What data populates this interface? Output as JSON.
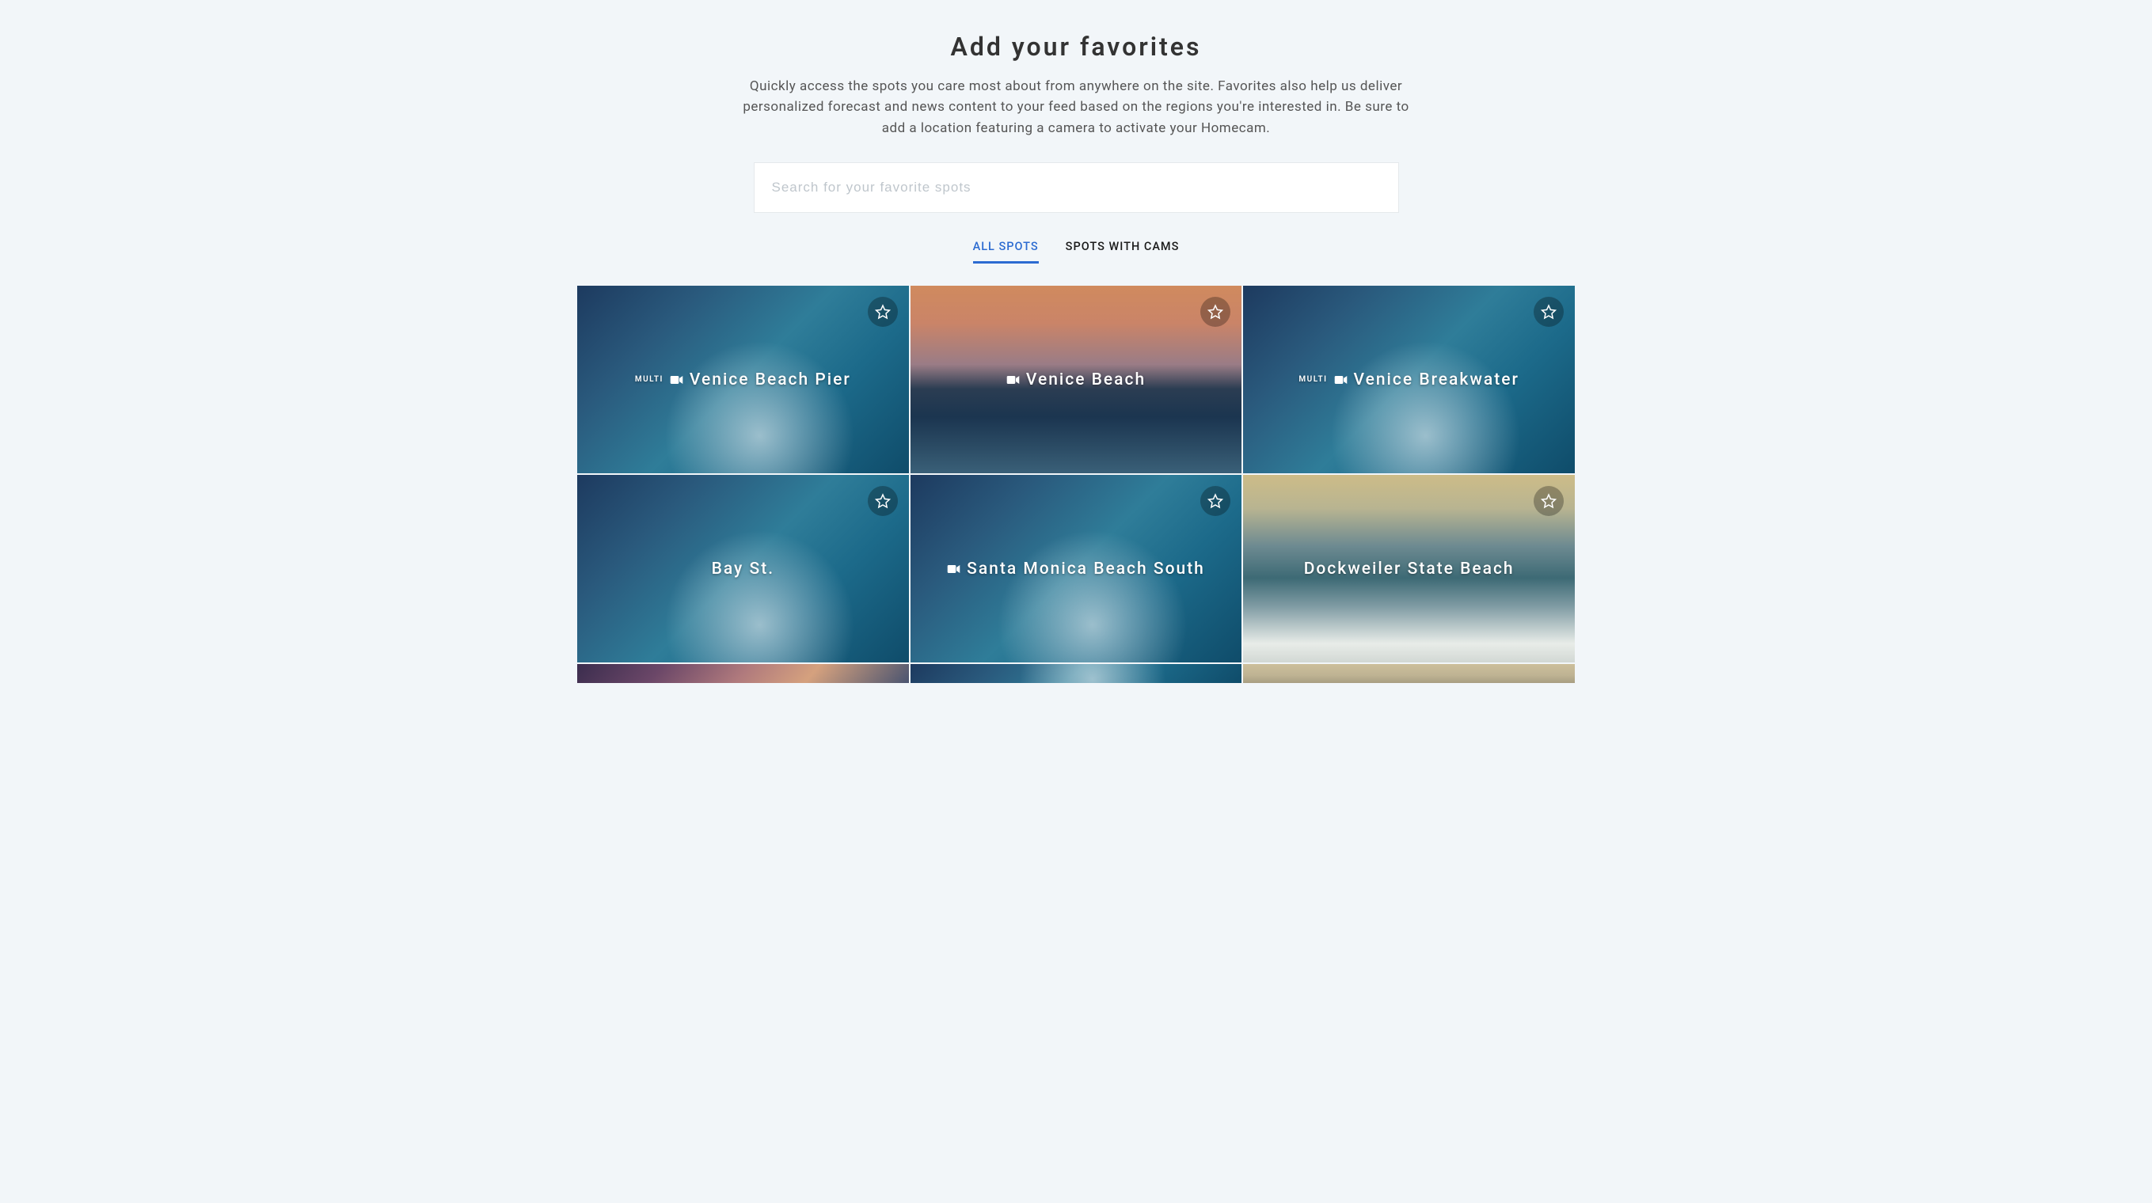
{
  "header": {
    "title": "Add your favorites",
    "subtitle": "Quickly access the spots you care most about from anywhere on the site. Favorites also help us deliver personalized forecast and news content to your feed based on the regions you're interested in. Be sure to add a location featuring a camera to activate your Homecam."
  },
  "search": {
    "placeholder": "Search for your favorite spots"
  },
  "tabs": {
    "all": "ALL SPOTS",
    "cams": "SPOTS WITH CAMS"
  },
  "multi_label": "MULTI",
  "spots": [
    {
      "name": "Venice Beach Pier",
      "multi": true,
      "cam": true,
      "bg": "bg-wave"
    },
    {
      "name": "Venice Beach",
      "multi": false,
      "cam": true,
      "bg": "bg-sunset"
    },
    {
      "name": "Venice Breakwater",
      "multi": true,
      "cam": true,
      "bg": "bg-wave"
    },
    {
      "name": "Bay St.",
      "multi": false,
      "cam": false,
      "bg": "bg-wave"
    },
    {
      "name": "Santa Monica Beach South",
      "multi": false,
      "cam": true,
      "bg": "bg-wave"
    },
    {
      "name": "Dockweiler State Beach",
      "multi": false,
      "cam": false,
      "bg": "bg-foam"
    }
  ]
}
